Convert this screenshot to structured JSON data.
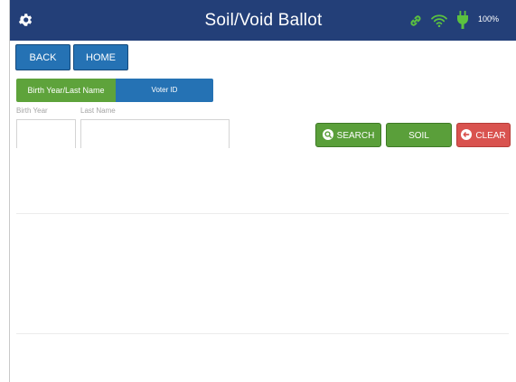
{
  "header": {
    "title": "Soil/Void Ballot",
    "battery": "100%"
  },
  "nav": {
    "back_label": "BACK",
    "home_label": "HOME"
  },
  "search_mode": {
    "options": [
      "Birth Year/Last Name",
      "Voter ID"
    ],
    "selected": "Birth Year/Last Name"
  },
  "fields": {
    "birth_year_label": "Birth Year",
    "birth_year_value": "",
    "last_name_label": "Last Name",
    "last_name_value": ""
  },
  "actions": {
    "search_label": "SEARCH",
    "soil_label": "SOIL",
    "clear_label": "CLEAR"
  },
  "colors": {
    "header_bg": "#233f78",
    "primary_blue": "#2572b4",
    "green": "#5a9f3a",
    "status_green": "#5bc23f",
    "red": "#d9534f"
  },
  "icons": {
    "settings": "gear-icon",
    "link": "link-icon",
    "wifi": "wifi-icon",
    "power": "plug-icon",
    "search": "search-icon",
    "clear": "clear-icon"
  }
}
